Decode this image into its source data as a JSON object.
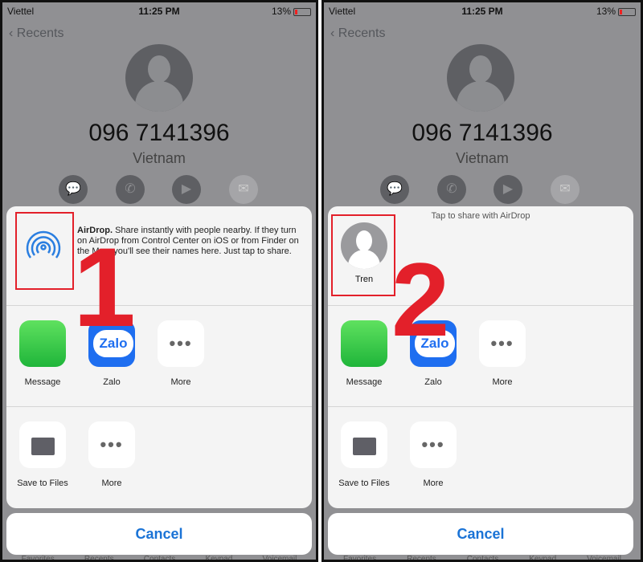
{
  "status": {
    "carrier": "Viettel",
    "time": "11:25 PM",
    "battery": "13%"
  },
  "nav": {
    "back": "Recents"
  },
  "contact": {
    "number": "096 7141396",
    "country": "Vietnam"
  },
  "actions": [
    "message-icon",
    "phone-icon",
    "video-icon",
    "mail-icon"
  ],
  "airdrop": {
    "title": "AirDrop.",
    "description": "Share instantly with people nearby. If they turn on AirDrop from Control Center on iOS or from Finder on the Mac, you'll see their names here. Just tap to share.",
    "hint": "Tap to share with AirDrop",
    "person": "Tren"
  },
  "apps": [
    {
      "label": "Message"
    },
    {
      "label": "Zalo",
      "icon_text": "Zalo"
    },
    {
      "label": "More"
    }
  ],
  "actions_row": [
    {
      "label": "Save to Files"
    },
    {
      "label": "More"
    }
  ],
  "cancel": "Cancel",
  "tabbar": [
    "Favorites",
    "Recents",
    "Contacts",
    "Keypad",
    "Voicemail"
  ],
  "annotations": {
    "step1": "1",
    "step2": "2",
    "color": "#e3202a"
  },
  "colors": {
    "accent": "#1a73d6",
    "annotation": "#e3202a"
  }
}
